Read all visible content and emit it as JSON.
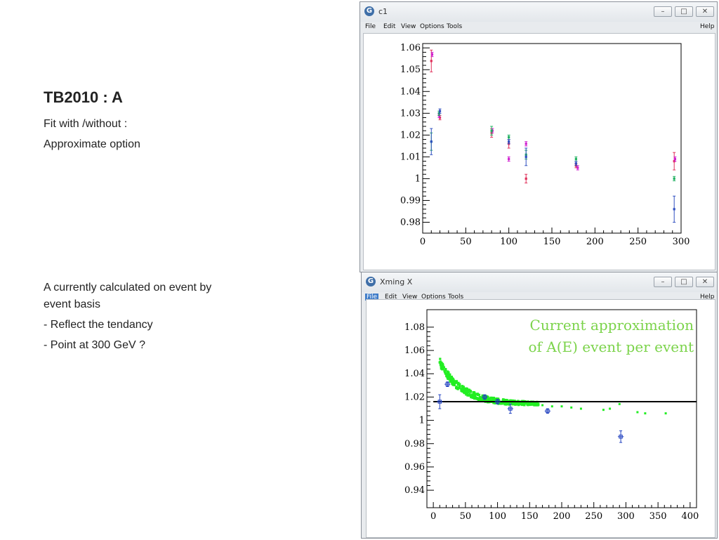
{
  "slide": {
    "title": "TB2010 :  A",
    "line1": "Fit  with /without  :",
    "line2": "Approximate option",
    "para": {
      "line_a": "A currently calculated on event by",
      "line_b": "event basis",
      "bullet1": "- Reflect the tendancy",
      "bullet2": "- Point at 300 GeV ?"
    }
  },
  "window_top": {
    "title": "c1",
    "menu": [
      "File",
      "Edit",
      "View",
      "Options",
      "Tools"
    ],
    "help": "Help",
    "controls": {
      "minimize": "–",
      "maximize": "□",
      "close": "✕"
    }
  },
  "window_bottom": {
    "title": "Xming X",
    "menu": [
      "File",
      "Edit",
      "View",
      "Options",
      "Tools"
    ],
    "help": "Help",
    "controls": {
      "minimize": "–",
      "maximize": "□",
      "close": "✕"
    },
    "annotation_line1": "Current approximation",
    "annotation_line2": "of A(E) event per event",
    "annotation_color": "#7bd34a"
  },
  "chart_data": [
    {
      "type": "scatter",
      "xlim": [
        0,
        300
      ],
      "ylim": [
        0.975,
        1.062
      ],
      "x_ticks": [
        0,
        50,
        100,
        150,
        200,
        250,
        300
      ],
      "y_ticks": [
        0.98,
        0.99,
        1,
        1.01,
        1.02,
        1.03,
        1.04,
        1.05,
        1.06
      ],
      "y_tick_labels": [
        "0.98",
        "0.99",
        "1",
        "1.01",
        "1.02",
        "1.03",
        "1.04",
        "1.05",
        "1.06"
      ],
      "series": [
        {
          "color": "#e0305a",
          "points": [
            [
              10,
              1.054,
              0.005
            ],
            [
              20,
              1.028,
              0.001
            ],
            [
              80,
              1.021,
              0.002
            ],
            [
              100,
              1.016,
              0.002
            ],
            [
              120,
              1.0,
              0.002
            ],
            [
              178,
              1.006,
              0.001
            ],
            [
              292,
              1.008,
              0.004
            ]
          ]
        },
        {
          "color": "#d020d0",
          "points": [
            [
              11,
              1.057,
              0.001
            ],
            [
              19,
              1.029,
              0.001
            ],
            [
              81,
              1.022,
              0.001
            ],
            [
              100,
              1.009,
              0.001
            ],
            [
              120,
              1.016,
              0.001
            ],
            [
              180,
              1.005,
              0.001
            ],
            [
              293,
              1.009,
              0.001
            ]
          ]
        },
        {
          "color": "#20b060",
          "points": [
            [
              10,
              1.017,
              0.004
            ],
            [
              19,
              1.03,
              0.001
            ],
            [
              80,
              1.022,
              0.002
            ],
            [
              100,
              1.019,
              0.001
            ],
            [
              120,
              1.011,
              0.002
            ],
            [
              178,
              1.009,
              0.001
            ],
            [
              292,
              1.0,
              0.001
            ]
          ]
        },
        {
          "color": "#3050c0",
          "points": [
            [
              10,
              1.017,
              0.006
            ],
            [
              20,
              1.031,
              0.001
            ],
            [
              100,
              1.017,
              0.001
            ],
            [
              120,
              1.01,
              0.004
            ],
            [
              178,
              1.007,
              0.001
            ],
            [
              292,
              0.986,
              0.006
            ]
          ]
        }
      ]
    },
    {
      "type": "scatter",
      "xlim": [
        -10,
        410
      ],
      "ylim": [
        0.925,
        1.095
      ],
      "x_ticks": [
        0,
        50,
        100,
        150,
        200,
        250,
        300,
        350,
        400
      ],
      "y_ticks": [
        0.94,
        0.96,
        0.98,
        1,
        1.02,
        1.04,
        1.06,
        1.08
      ],
      "y_tick_labels": [
        "0.94",
        "0.96",
        "0.98",
        "1",
        "1.02",
        "1.04",
        "1.06",
        "1.08"
      ],
      "reference_line_y": 1.016,
      "reference_line_xrange": [
        0,
        415
      ],
      "green_curve": {
        "color": "#22ee22",
        "x_start": 10,
        "x_end": 165,
        "y_start": 1.05,
        "asymptote": 1.014,
        "scatter": 0.007
      },
      "green_tail": [
        [
          170,
          1.013
        ],
        [
          185,
          1.012
        ],
        [
          200,
          1.012
        ],
        [
          215,
          1.011
        ],
        [
          230,
          1.01
        ],
        [
          265,
          1.009
        ],
        [
          275,
          1.01
        ],
        [
          290,
          1.014
        ],
        [
          318,
          1.007
        ],
        [
          330,
          1.006
        ],
        [
          362,
          1.006
        ]
      ],
      "blue_points": [
        [
          10,
          1.016,
          0.006
        ],
        [
          22,
          1.031,
          0.002
        ],
        [
          80,
          1.02,
          0.002
        ],
        [
          100,
          1.016,
          0.002
        ],
        [
          120,
          1.01,
          0.004
        ],
        [
          178,
          1.008,
          0.002
        ],
        [
          292,
          0.986,
          0.005
        ]
      ]
    }
  ]
}
